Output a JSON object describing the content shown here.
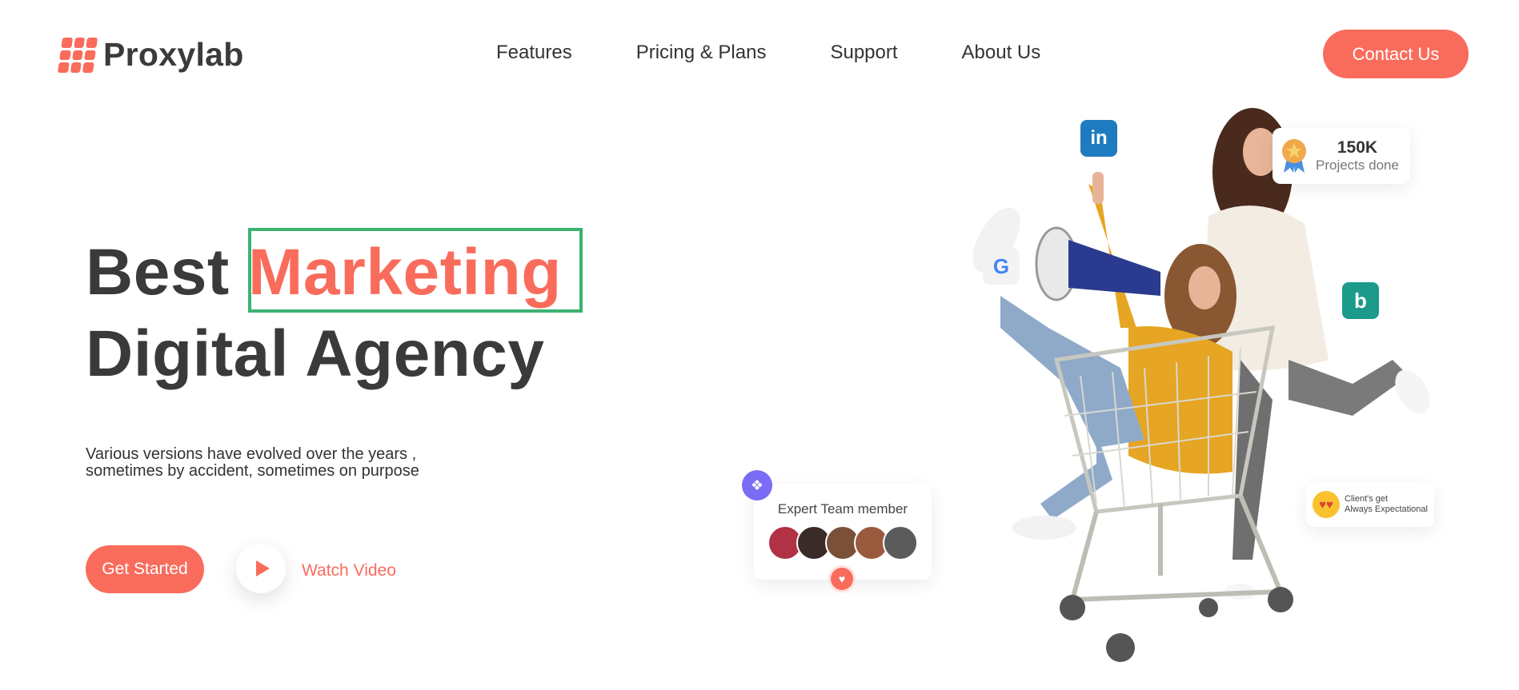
{
  "brand": {
    "name": "Proxylab",
    "accent": "#f96c5c"
  },
  "nav": {
    "items": [
      "Features",
      "Pricing & Plans",
      "Support",
      "About Us"
    ]
  },
  "header": {
    "contact_label": "Contact Us"
  },
  "hero": {
    "title_line1_prefix": "Best",
    "title_line1_accent": "Marketing",
    "title_line2": "Digital Agency",
    "desc_line1": "Various versions have evolved over the years ,",
    "desc_line2": "sometimes by accident, sometimes on purpose",
    "cta_label": "Get Started",
    "video_label": "Watch Video"
  },
  "stats": {
    "value": "150K",
    "label": "Projects done"
  },
  "team": {
    "title": "Expert Team member"
  },
  "client": {
    "line1": "Client's get",
    "line2": "Always Expectational"
  },
  "icons": {
    "linkedin": "linkedin-icon",
    "google": "google-icon",
    "bing": "bing-icon",
    "play": "play-icon",
    "heart": "heart-icon",
    "gift": "gift-icon",
    "award": "award-icon"
  },
  "social_text": {
    "linkedin": "in",
    "google": "G",
    "bing": "b"
  }
}
